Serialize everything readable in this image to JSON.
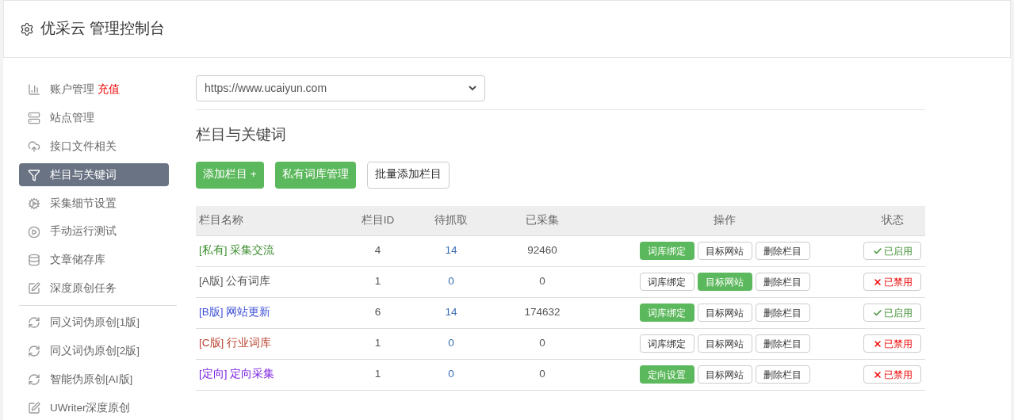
{
  "header": {
    "title": "优采云 管理控制台"
  },
  "sidebar": {
    "items": [
      {
        "label": "账户管理",
        "badge": "充值",
        "selected": false
      },
      {
        "label": "站点管理",
        "selected": false
      },
      {
        "label": "接口文件相关",
        "selected": false
      },
      {
        "label": "栏目与关键词",
        "selected": true
      },
      {
        "label": "采集细节设置",
        "selected": false
      },
      {
        "label": "手动运行测试",
        "selected": false
      },
      {
        "label": "文章储存库",
        "selected": false
      },
      {
        "label": "深度原创任务",
        "selected": false
      },
      {
        "label": "同义词伪原创[1版]",
        "selected": false
      },
      {
        "label": "同义词伪原创[2版]",
        "selected": false
      },
      {
        "label": "智能伪原创[AI版]",
        "selected": false
      },
      {
        "label": "UWriter深度原创",
        "selected": false
      }
    ]
  },
  "site_select": {
    "value": "https://www.ucaiyun.com"
  },
  "heading": "栏目与关键词",
  "toolbar": [
    {
      "label": "添加栏目 +",
      "primary": true
    },
    {
      "label": "私有词库管理",
      "primary": true
    },
    {
      "label": "批量添加栏目",
      "primary": false
    }
  ],
  "table": {
    "columns": [
      "栏目名称",
      "栏目ID",
      "待抓取",
      "已采集",
      "操作",
      "状态"
    ],
    "rows": [
      {
        "tag": "[私有]",
        "name": "采集交流",
        "color": "#3c8d2f",
        "id": "4",
        "pending": "14",
        "collected": "92460",
        "actions": [
          {
            "label": "词库绑定",
            "highlighted": true
          },
          {
            "label": "目标网站",
            "highlighted": false
          },
          {
            "label": "删除栏目",
            "highlighted": false
          }
        ],
        "status": {
          "label": "已启用",
          "enabled": true
        }
      },
      {
        "tag": "[A版]",
        "name": "公有词库",
        "color": "#555555",
        "id": "1",
        "pending": "0",
        "collected": "0",
        "actions": [
          {
            "label": "词库绑定",
            "highlighted": false
          },
          {
            "label": "目标网站",
            "highlighted": true
          },
          {
            "label": "删除栏目",
            "highlighted": false
          }
        ],
        "status": {
          "label": "已禁用",
          "enabled": false
        }
      },
      {
        "tag": "[B版]",
        "name": "网站更新",
        "color": "#3f51d6",
        "id": "6",
        "pending": "14",
        "collected": "174632",
        "actions": [
          {
            "label": "词库绑定",
            "highlighted": true
          },
          {
            "label": "目标网站",
            "highlighted": false
          },
          {
            "label": "删除栏目",
            "highlighted": false
          }
        ],
        "status": {
          "label": "已启用",
          "enabled": true
        }
      },
      {
        "tag": "[C版]",
        "name": "行业词库",
        "color": "#b8432f",
        "id": "1",
        "pending": "0",
        "collected": "0",
        "actions": [
          {
            "label": "词库绑定",
            "highlighted": false
          },
          {
            "label": "目标网站",
            "highlighted": false
          },
          {
            "label": "删除栏目",
            "highlighted": false
          }
        ],
        "status": {
          "label": "已禁用",
          "enabled": false
        }
      },
      {
        "tag": "[定向]",
        "name": "定向采集",
        "color": "#7a1fe0",
        "id": "1",
        "pending": "0",
        "collected": "0",
        "actions": [
          {
            "label": "定向设置",
            "highlighted": true
          },
          {
            "label": "目标网站",
            "highlighted": false
          },
          {
            "label": "删除栏目",
            "highlighted": false
          }
        ],
        "status": {
          "label": "已禁用",
          "enabled": false
        }
      }
    ]
  }
}
